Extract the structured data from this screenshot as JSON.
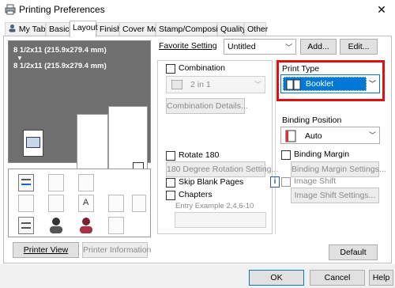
{
  "window": {
    "title": "Printing Preferences",
    "close_glyph": "✕"
  },
  "tabs": [
    "My Tab",
    "Basic",
    "Layout",
    "Finish",
    "Cover Mode",
    "Stamp/Composition",
    "Quality",
    "Other"
  ],
  "favorite": {
    "label": "Favorite Setting",
    "value": "Untitled",
    "add_label": "Add...",
    "edit_label": "Edit..."
  },
  "preview": {
    "line1": "8 1/2x11 (215.9x279.4 mm)",
    "arrow": "▼",
    "line2": "8 1/2x11 (215.9x279.4 mm)",
    "copies": "x1"
  },
  "left_buttons": {
    "printer_view": "Printer View",
    "printer_info": "Printer Information"
  },
  "middle": {
    "combination_label": "Combination",
    "combination_value": "2 in 1",
    "combination_details": "Combination Details...",
    "rotate_label": "Rotate 180",
    "rotation_setting": "180 Degree Rotation Setting...",
    "skip_blank": "Skip Blank Pages",
    "chapters": "Chapters",
    "entry_example": "Entry Example 2,4,6-10"
  },
  "right": {
    "print_type_label": "Print Type",
    "print_type_value": "Booklet",
    "binding_position_label": "Binding Position",
    "binding_position_value": "Auto",
    "binding_margin_label": "Binding Margin",
    "binding_margin_settings": "Binding Margin Settings...",
    "image_shift_label": "Image Shift",
    "image_shift_settings": "Image Shift Settings...",
    "info_glyph": "i"
  },
  "default_label": "Default",
  "dialog": {
    "ok": "OK",
    "cancel": "Cancel",
    "help": "Help"
  },
  "colors": {
    "accent": "#0078d7",
    "highlight": "#e01010"
  }
}
